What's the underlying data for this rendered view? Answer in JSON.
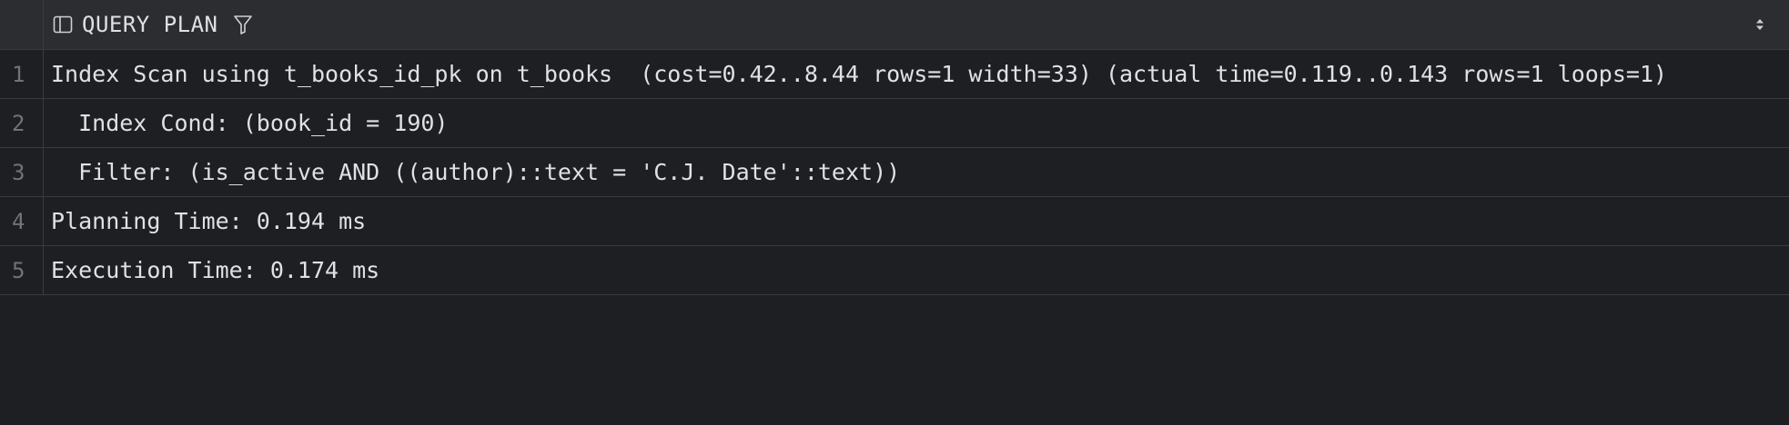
{
  "result_grid": {
    "column_header": "QUERY PLAN",
    "rows": [
      {
        "num": "1",
        "text": "Index Scan using t_books_id_pk on t_books  (cost=0.42..8.44 rows=1 width=33) (actual time=0.119..0.143 rows=1 loops=1)"
      },
      {
        "num": "2",
        "text": "  Index Cond: (book_id = 190)"
      },
      {
        "num": "3",
        "text": "  Filter: (is_active AND ((author)::text = 'C.J. Date'::text))"
      },
      {
        "num": "4",
        "text": "Planning Time: 0.194 ms"
      },
      {
        "num": "5",
        "text": "Execution Time: 0.174 ms"
      }
    ]
  },
  "icons": {
    "column_type": "column-icon",
    "filter": "filter-icon",
    "sort": "sort-icon"
  },
  "colors": {
    "background": "#1e1f22",
    "header_background": "#2b2d30",
    "grid_line": "#393b40",
    "text": "#dfe1e5",
    "line_number": "#6f737a"
  }
}
